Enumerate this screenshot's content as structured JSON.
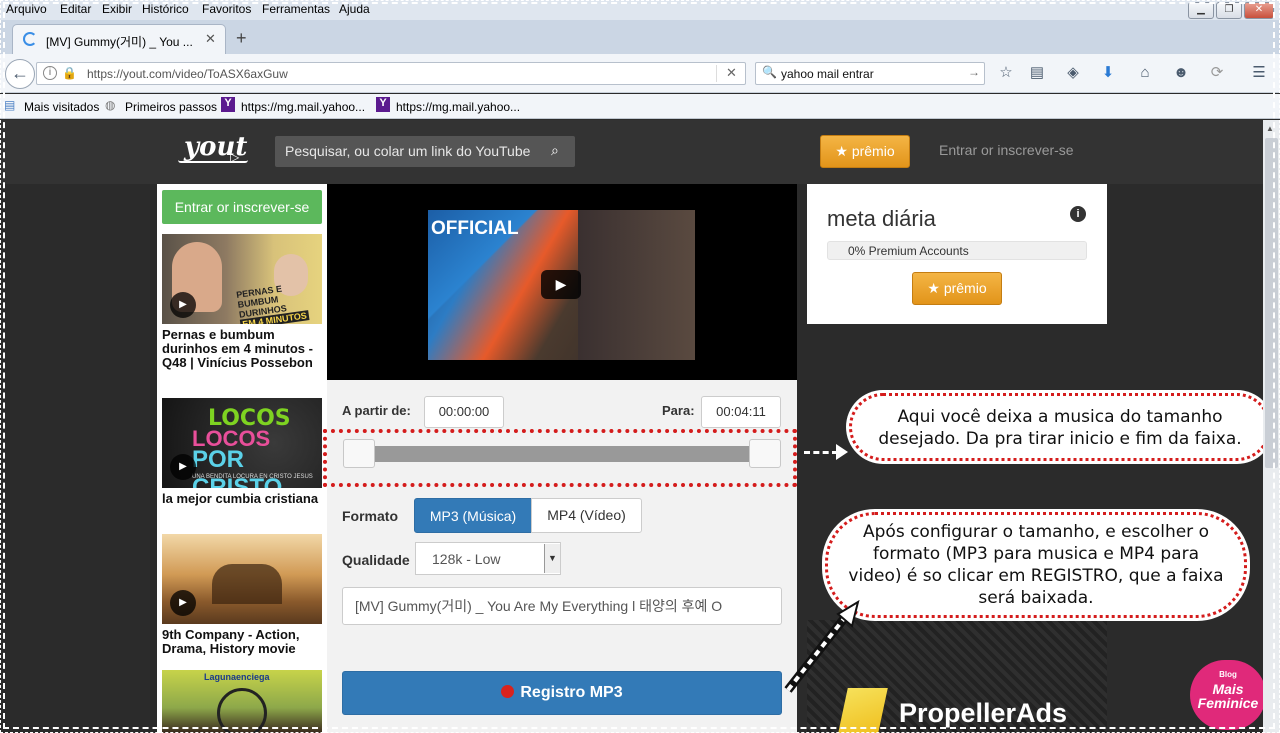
{
  "browser": {
    "menu": [
      "Arquivo",
      "Editar",
      "Exibir",
      "Histórico",
      "Favoritos",
      "Ferramentas",
      "Ajuda"
    ],
    "tab_title": "[MV] Gummy(거미) _ You ...",
    "url": "https://yout.com/video/ToASX6axGuw",
    "search_value": "yahoo mail entrar",
    "bookmarks": [
      "Mais visitados",
      "Primeiros passos",
      "https://mg.mail.yahoo...",
      "https://mg.mail.yahoo..."
    ]
  },
  "header": {
    "logo_text": "yout",
    "search_placeholder": "Pesquisar, ou colar um link do YouTube",
    "premio_label": "★ prêmio",
    "signin_label": "Entrar or inscrever-se"
  },
  "sidebar": {
    "signin_button": "Entrar or inscrever-se",
    "videos": [
      {
        "title": "Pernas e bumbum durinhos em 4 minutos - Q48 | Vinícius Possebon",
        "thumb_text": [
          "PERNAS E",
          "BUMBUM DURINHOS",
          "EM 4 MINUTOS"
        ],
        "thumb_color": "#c9b36a"
      },
      {
        "title": "la mejor cumbia cristiana",
        "thumb_text": [
          "LOCOS",
          "LOCOS",
          "POR CRISTO",
          "UNA BENDITA LOCURA EN CRISTO JESUS"
        ],
        "thumb_color": "#2b2b2b"
      },
      {
        "title": "9th Company - Action, Drama, History movie",
        "thumb_text": [],
        "thumb_color": "#b07a3c"
      },
      {
        "title": "",
        "thumb_text": [
          "Lagunaenciega"
        ],
        "thumb_color": "#8ea24a"
      }
    ]
  },
  "player": {
    "overlay_text": "OFFICIAL"
  },
  "controls": {
    "from_label": "A partir de:",
    "from_value": "00:00:00",
    "to_label": "Para:",
    "to_value": "00:04:11",
    "format_label": "Formato",
    "format_mp3": "MP3 (Música)",
    "format_mp4": "MP4 (Vídeo)",
    "quality_label": "Qualidade",
    "quality_value": "128k - Low",
    "title_value": "[MV] Gummy(거미) _ You Are My Everything l 태양의 후예 O",
    "register_label": "Registro MP3"
  },
  "goal": {
    "title": "meta diária",
    "progress_text": "0% Premium Accounts",
    "progress": 0,
    "premio_label": "★ prêmio"
  },
  "ads": {
    "brand": "PropellerAds"
  },
  "annotations": {
    "callout1": "Aqui você deixa a musica do tamanho desejado. Da pra tirar inicio e fim da faixa.",
    "callout2": "Após configurar o tamanho, e escolher o formato (MP3 para musica e MP4 para video) é so clicar em REGISTRO, que a faixa será baixada.",
    "badge_small": "Blog",
    "badge_line1": "Mais",
    "badge_line2": "Feminice"
  },
  "colors": {
    "accent_blue": "#337ab7",
    "green": "#5cb85c",
    "orange": "#f0a030",
    "annotation_red": "#d41c1c"
  }
}
